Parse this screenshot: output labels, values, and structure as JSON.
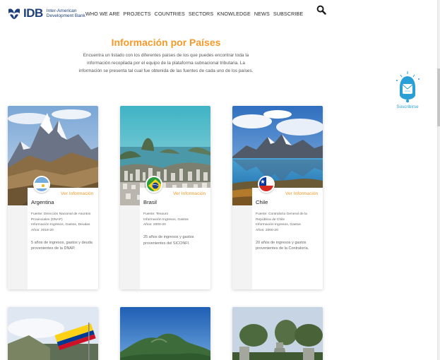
{
  "header": {
    "logo_abbr": "IDB",
    "logo_line1": "Inter-American",
    "logo_line2": "Development Bank",
    "nav": [
      "WHO WE ARE",
      "PROJECTS",
      "COUNTRIES",
      "SECTORS",
      "KNOWLEDGE",
      "NEWS",
      "SUBSCRIBE"
    ],
    "search_icon": "search-icon"
  },
  "intro": {
    "title": "Información por Países",
    "text": "Encuentra un listado con los diferentes países de los que puedes encontrar toda la información recopilada por el equipo de la plataforma subnacional tributaria. La información se presenta tal cual fue obtenida de las fuentes de cada uno de los países."
  },
  "subscribe": {
    "label": "Suscribirse",
    "icon": "mail-bell-icon"
  },
  "colors": {
    "accent": "#f39a2a",
    "brand": "#1d3f7a",
    "link": "#2a9fd6"
  },
  "cards": [
    {
      "country": "Argentina",
      "link": "Ver Información",
      "fuente": "Fuente: Dirección Nacional de Asuntos Provinciales (DNAP)",
      "info": "Información Ingresos, Gastos, Deudas",
      "anos": "Años: 2018-20",
      "desc": "5 años de ingresos, gastos y deuda provenientes de la DNAP."
    },
    {
      "country": "Brasil",
      "link": "Ver Información",
      "fuente": "Fuente: Tesouro",
      "info": "Información Ingresos, Gastos",
      "anos": "Años: 2000-20",
      "desc": "25 años de ingresos y gastos provenientes del SICONFI."
    },
    {
      "country": "Chile",
      "link": "Ver Información",
      "fuente": "Fuente: Contraloría General de la República de Chile",
      "info": "Información Ingresos, Gastos",
      "anos": "Años: 2000-20",
      "desc": "20 años de ingresos y gastos provenientes de la Contraloría."
    }
  ]
}
